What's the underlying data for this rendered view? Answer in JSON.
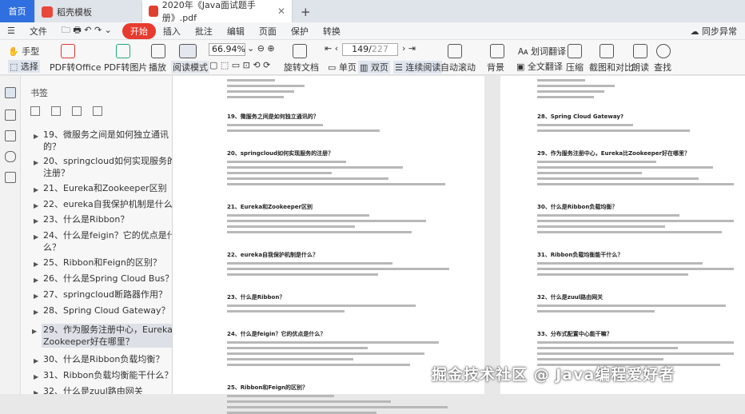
{
  "tabs": {
    "home": "首页",
    "template": "稻壳模板",
    "file": "2020年《Java面试题手册》.pdf"
  },
  "menu": [
    "文件",
    "开始",
    "插入",
    "批注",
    "编辑",
    "页面",
    "保护",
    "转换"
  ],
  "sync": "同步异常",
  "toolbar": {
    "hand": "手型",
    "select": "选择",
    "pdf_office": "PDF转Office",
    "pdf_image": "PDF转图片",
    "play": "播放",
    "read_mode": "阅读模式",
    "zoom": "66.94%",
    "rotate": "旋转文档",
    "page_current": "149",
    "page_total": "227",
    "single": "单页",
    "double": "双页",
    "continuous": "连续阅读",
    "auto_scroll": "自动滚动",
    "background": "背景",
    "translate_word": "划词翻译",
    "translate_full": "全文翻译",
    "compress": "压缩",
    "screenshot": "截图和对比",
    "read": "朗读",
    "find": "查找"
  },
  "panel": {
    "title": "书签"
  },
  "bookmarks": [
    "19、微服务之间是如何独立通讯的？",
    "20、springcloud如何实现服务的注册？",
    "21、Eureka和Zookeeper区别",
    "22、eureka自我保护机制是什么？",
    "23、什么是Ribbon？",
    "24、什么是feigin？它的优点是什么？",
    "25、Ribbon和Feign的区别？",
    "26、什么是Spring Cloud Bus？",
    "27、springcloud断路器作用？",
    "28、Spring Cloud Gateway？",
    "29、作为服务注册中心，Eureka比Zookeeper好在哪里？",
    "30、什么是Ribbon负载均衡？",
    "31、Ribbon负载均衡能干什么？",
    "32、什么是zuul路由网关"
  ],
  "left_page": [
    "19、微服务之间是如何独立通讯的？",
    "20、springcloud如何实现服务的注册？",
    "21、Eureka和Zookeeper区别",
    "22、eureka自我保护机制是什么？",
    "23、什么是Ribbon？",
    "24、什么是feigin？它的优点是什么？",
    "25、Ribbon和Feign的区别？"
  ],
  "right_page": [
    "28、Spring Cloud Gateway?",
    "29、作为服务注册中心，Eureka比Zookeeper好在哪里？",
    "30、什么是Ribbon负载均衡？",
    "31、Ribbon负载均衡能干什么？",
    "32、什么是zuul路由网关",
    "33、分布式配置中心能干嘛？"
  ],
  "watermark": "掘金技术社区 @ Java编程爱好者"
}
